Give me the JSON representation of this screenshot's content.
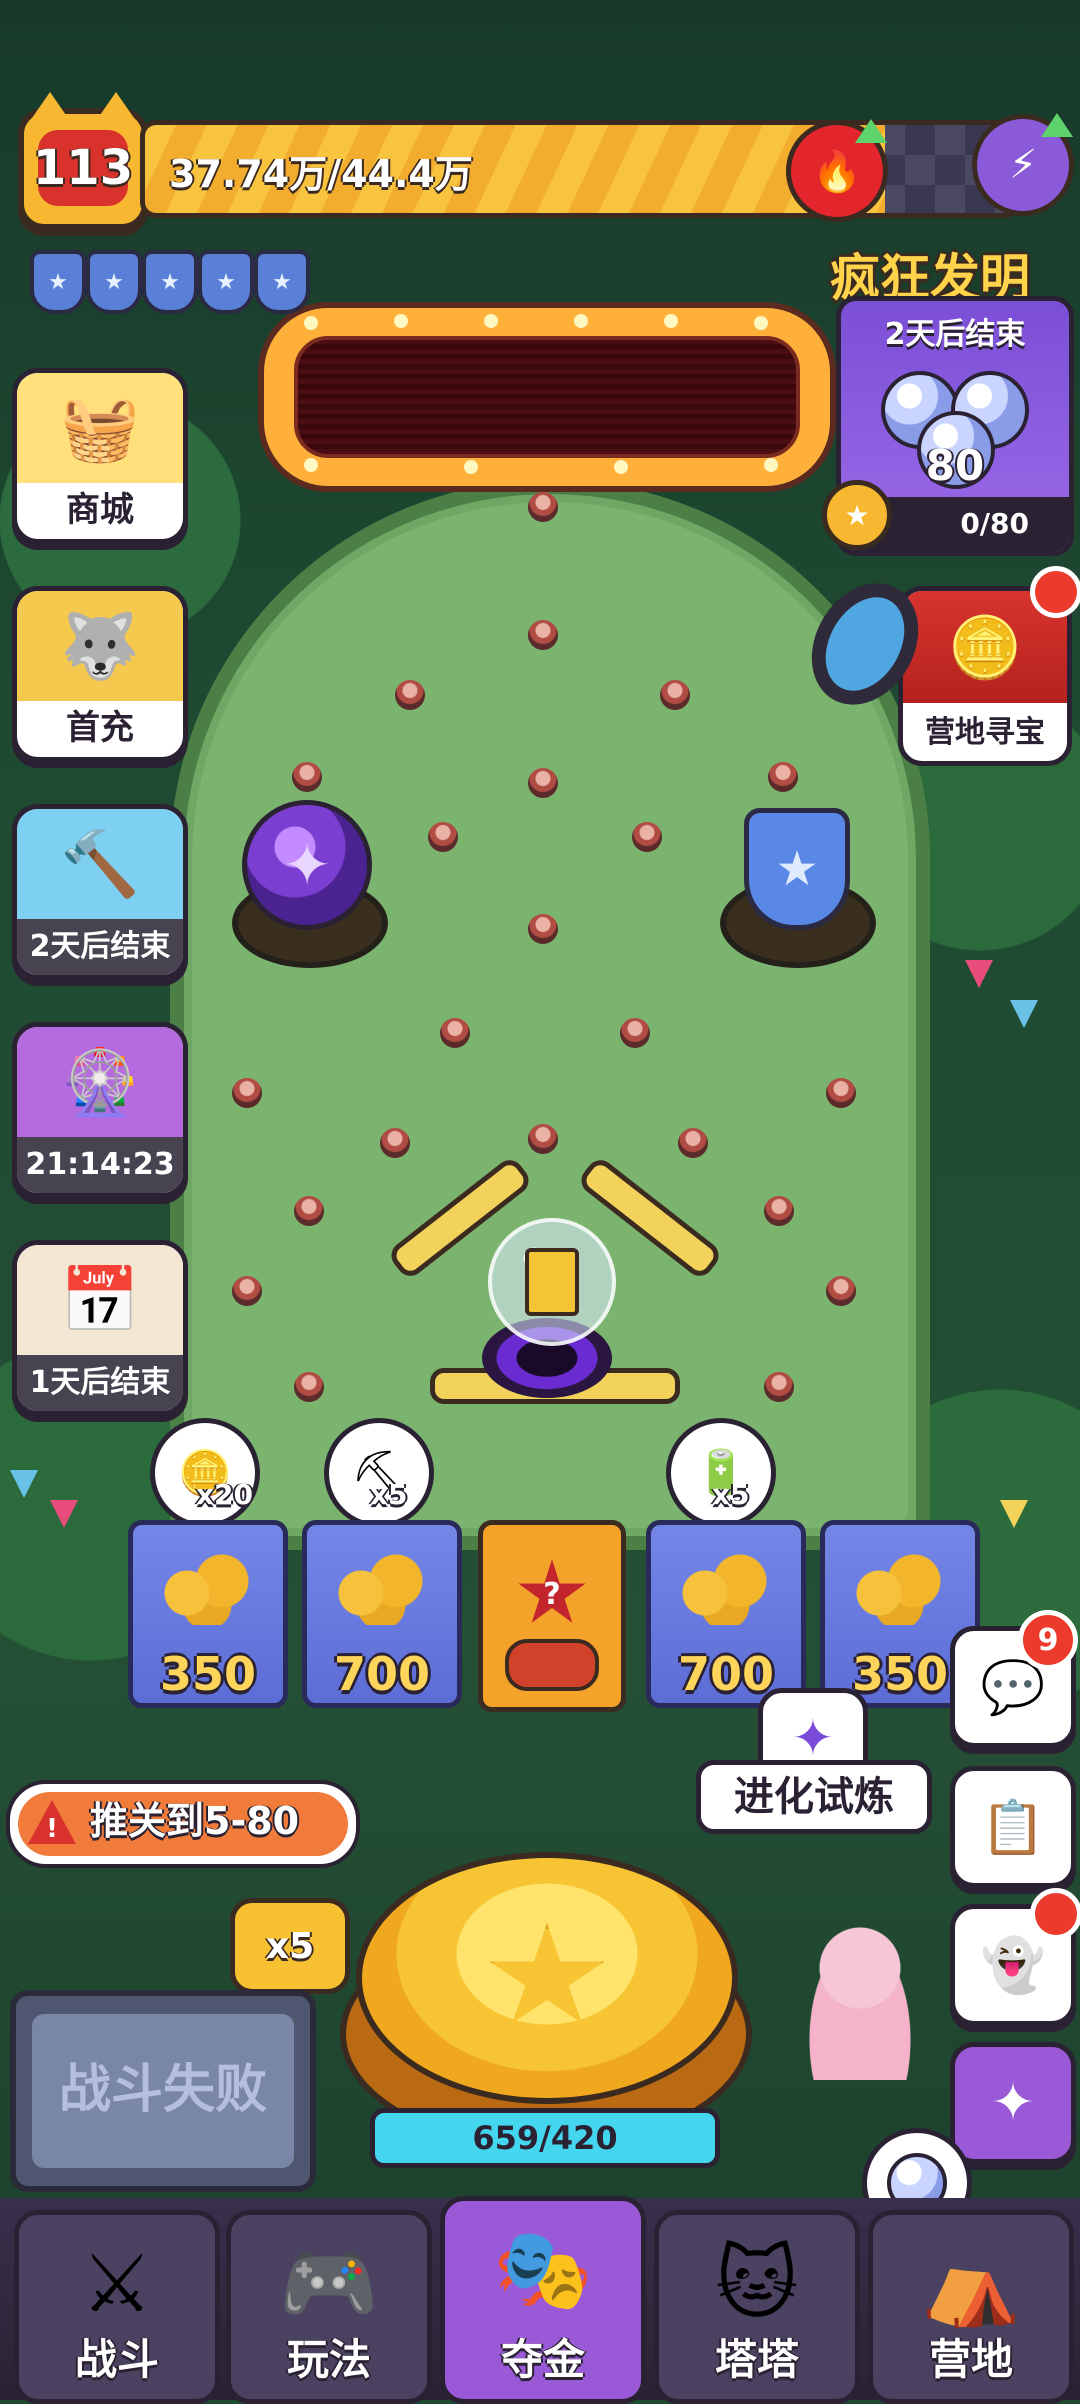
{
  "player": {
    "level": "113",
    "xp_text": "37.74万/44.4万",
    "xp_fraction": 0.85,
    "shields_count": 5
  },
  "event": {
    "title": "疯狂发明",
    "timer": "2天后结束",
    "orb_count": "80",
    "progress": "0/80"
  },
  "left_menu": [
    {
      "label": "商城",
      "icon": "shopping-basket-icon"
    },
    {
      "label": "首充",
      "icon": "first-recharge-mascot-icon"
    },
    {
      "label": "2天后结束",
      "icon": "hammer-icon"
    },
    {
      "label": "21:14:23",
      "icon": "wheel-icon"
    },
    {
      "label": "1天后结束",
      "icon": "calendar-icon"
    }
  ],
  "camp_treasure": {
    "label": "营地寻宝"
  },
  "rewards": [
    {
      "count": "x20",
      "icon": "coin-icon"
    },
    {
      "count": "x5",
      "icon": "pickaxe-icon"
    },
    {
      "count": "x5",
      "icon": "battery-icon"
    }
  ],
  "slots": [
    {
      "value": "350"
    },
    {
      "value": "700"
    },
    {
      "value": "?"
    },
    {
      "value": "700"
    },
    {
      "value": "350"
    }
  ],
  "evolve": {
    "label": "进化试炼"
  },
  "warning": {
    "text": "推关到5-80"
  },
  "chat_badge": "9",
  "multiplier": "x5",
  "energy": "659/420",
  "battle_status": "战斗失败",
  "nav": [
    {
      "label": "战斗",
      "icon": "crossed-swords-icon"
    },
    {
      "label": "玩法",
      "icon": "gamepad-icon"
    },
    {
      "label": "夺金",
      "icon": "masks-icon",
      "active": true
    },
    {
      "label": "塔塔",
      "icon": "cat-icon"
    },
    {
      "label": "营地",
      "icon": "tent-icon"
    }
  ],
  "colors": {
    "field_green": "#7bb46f",
    "gold": "#f7c534",
    "accent_purple": "#9a5ad8",
    "danger": "#d9312b"
  }
}
